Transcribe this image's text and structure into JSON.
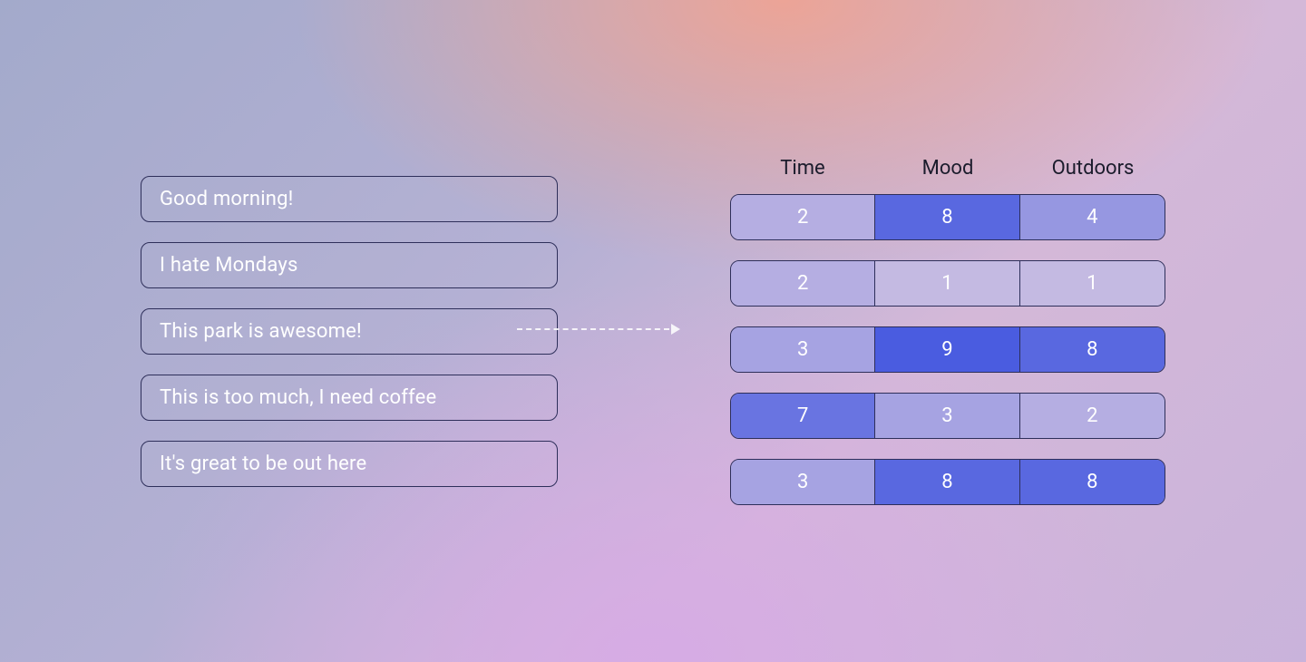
{
  "sentences": [
    "Good morning!",
    "I hate Mondays",
    "This park is awesome!",
    "This is too much, I need coffee",
    "It's great to be out here"
  ],
  "columns": [
    "Time",
    "Mood",
    "Outdoors"
  ],
  "rows": [
    {
      "time": 2,
      "mood": 8,
      "outdoors": 4
    },
    {
      "time": 2,
      "mood": 1,
      "outdoors": 1
    },
    {
      "time": 3,
      "mood": 9,
      "outdoors": 8
    },
    {
      "time": 7,
      "mood": 3,
      "outdoors": 2
    },
    {
      "time": 3,
      "mood": 8,
      "outdoors": 8
    }
  ],
  "arrow_from_index": 2
}
